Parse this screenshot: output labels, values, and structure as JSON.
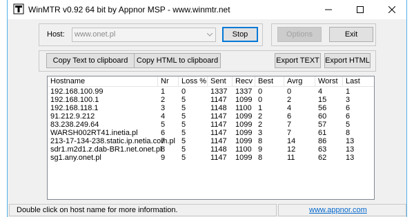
{
  "window": {
    "title": "WinMTR v0.92 64 bit by Appnor MSP - www.winmtr.net"
  },
  "host": {
    "label": "Host:",
    "value": "www.onet.pl"
  },
  "buttons": {
    "stop": "Stop",
    "options": "Options",
    "exit": "Exit",
    "copy_text": "Copy Text to clipboard",
    "copy_html": "Copy HTML to clipboard",
    "export_text": "Export TEXT",
    "export_html": "Export HTML"
  },
  "table": {
    "columns": [
      "Hostname",
      "Nr",
      "Loss %",
      "Sent",
      "Recv",
      "Best",
      "Avrg",
      "Worst",
      "Last"
    ],
    "rows": [
      [
        "192.168.100.99",
        "1",
        "0",
        "1337",
        "1337",
        "0",
        "0",
        "4",
        "1"
      ],
      [
        "192.168.100.1",
        "2",
        "5",
        "1147",
        "1099",
        "0",
        "2",
        "15",
        "3"
      ],
      [
        "192.168.118.1",
        "3",
        "5",
        "1148",
        "1100",
        "1",
        "4",
        "56",
        "6"
      ],
      [
        "91.212.9.212",
        "4",
        "5",
        "1147",
        "1099",
        "2",
        "6",
        "60",
        "6"
      ],
      [
        "83.238.249.64",
        "5",
        "5",
        "1147",
        "1099",
        "2",
        "7",
        "57",
        "5"
      ],
      [
        "WARSH002RT41.inetia.pl",
        "6",
        "5",
        "1147",
        "1099",
        "3",
        "7",
        "61",
        "8"
      ],
      [
        "213-17-134-238.static.ip.netia.com.pl",
        "7",
        "5",
        "1147",
        "1099",
        "8",
        "14",
        "86",
        "13"
      ],
      [
        "sdr1.m2d1.z.dab-BR1.net.onet.pl",
        "8",
        "5",
        "1148",
        "1100",
        "9",
        "12",
        "63",
        "13"
      ],
      [
        "sg1.any.onet.pl",
        "9",
        "5",
        "1147",
        "1099",
        "8",
        "11",
        "62",
        "13"
      ]
    ]
  },
  "status": {
    "message": "Double click on host name for more information.",
    "link": "www.appnor.com"
  },
  "icons": {
    "app": "winmtr-logo-icon",
    "minimize": "minimize-icon",
    "maximize": "maximize-icon",
    "close": "close-icon",
    "dropdown": "chevron-down-icon"
  }
}
